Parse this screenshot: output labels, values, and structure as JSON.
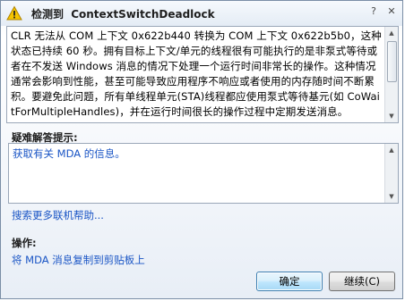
{
  "window": {
    "title_prefix": "检测到",
    "title_name": "ContextSwitchDeadlock",
    "help_glyph": "?",
    "close_glyph": "✕"
  },
  "message": {
    "text": "CLR 无法从 COM 上下文 0x622b440 转换为 COM 上下文 0x622b5b0，这种状态已持续 60 秒。拥有目标上下文/单元的线程很有可能执行的是非泵式等待或者在不发送 Windows 消息的情况下处理一个运行时间非常长的操作。这种情况通常会影响到性能，甚至可能导致应用程序不响应或者使用的内存随时间不断累积。要避免此问题，所有单线程单元(STA)线程都应使用泵式等待基元(如 CoWaitForMultipleHandles)，并在运行时间很长的操作过程中定期发送消息。"
  },
  "troubleshooting": {
    "label": "疑难解答提示:",
    "tip": "获取有关 MDA 的信息。"
  },
  "search_link": "搜索更多联机帮助...",
  "actions": {
    "label": "操作:",
    "copy_link": "将 MDA 消息复制到剪贴板上"
  },
  "buttons": {
    "ok": "确定",
    "continue": "继续(C)"
  },
  "colors": {
    "link": "#1a55c5",
    "warning": "#f2c200"
  },
  "icons": {
    "title": "warning-icon",
    "help": "help-icon",
    "close": "close-icon"
  }
}
